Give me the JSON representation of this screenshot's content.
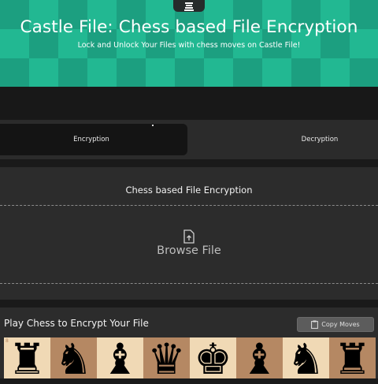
{
  "header": {
    "title": "Castle File: Chess based File Encryption",
    "subtitle": "Lock and Unlock Your Files with chess moves on Castle File!",
    "logo_icon": "chess-king-icon"
  },
  "tabs": [
    {
      "label": "Encryption",
      "active": true
    },
    {
      "label": "Decryption",
      "active": false
    }
  ],
  "encryption": {
    "title": "Chess based File Encryption",
    "browse_label": "Browse File",
    "upload_icon": "file-upload-icon"
  },
  "play": {
    "title": "Play Chess to Encrypt Your File",
    "copy_label": "Copy Moves",
    "copy_icon": "clipboard-icon",
    "rank_label": "8",
    "board_rank_8": [
      "♜",
      "♞",
      "♝",
      "♛",
      "♚",
      "♝",
      "♞",
      "♜"
    ],
    "board_rank_8_names": [
      "rook",
      "knight",
      "bishop",
      "queen",
      "king",
      "bishop",
      "knight",
      "rook"
    ]
  },
  "colors": {
    "accent": "#1fab8a",
    "board_light": "#f0d9b5",
    "board_dark": "#b58863"
  }
}
